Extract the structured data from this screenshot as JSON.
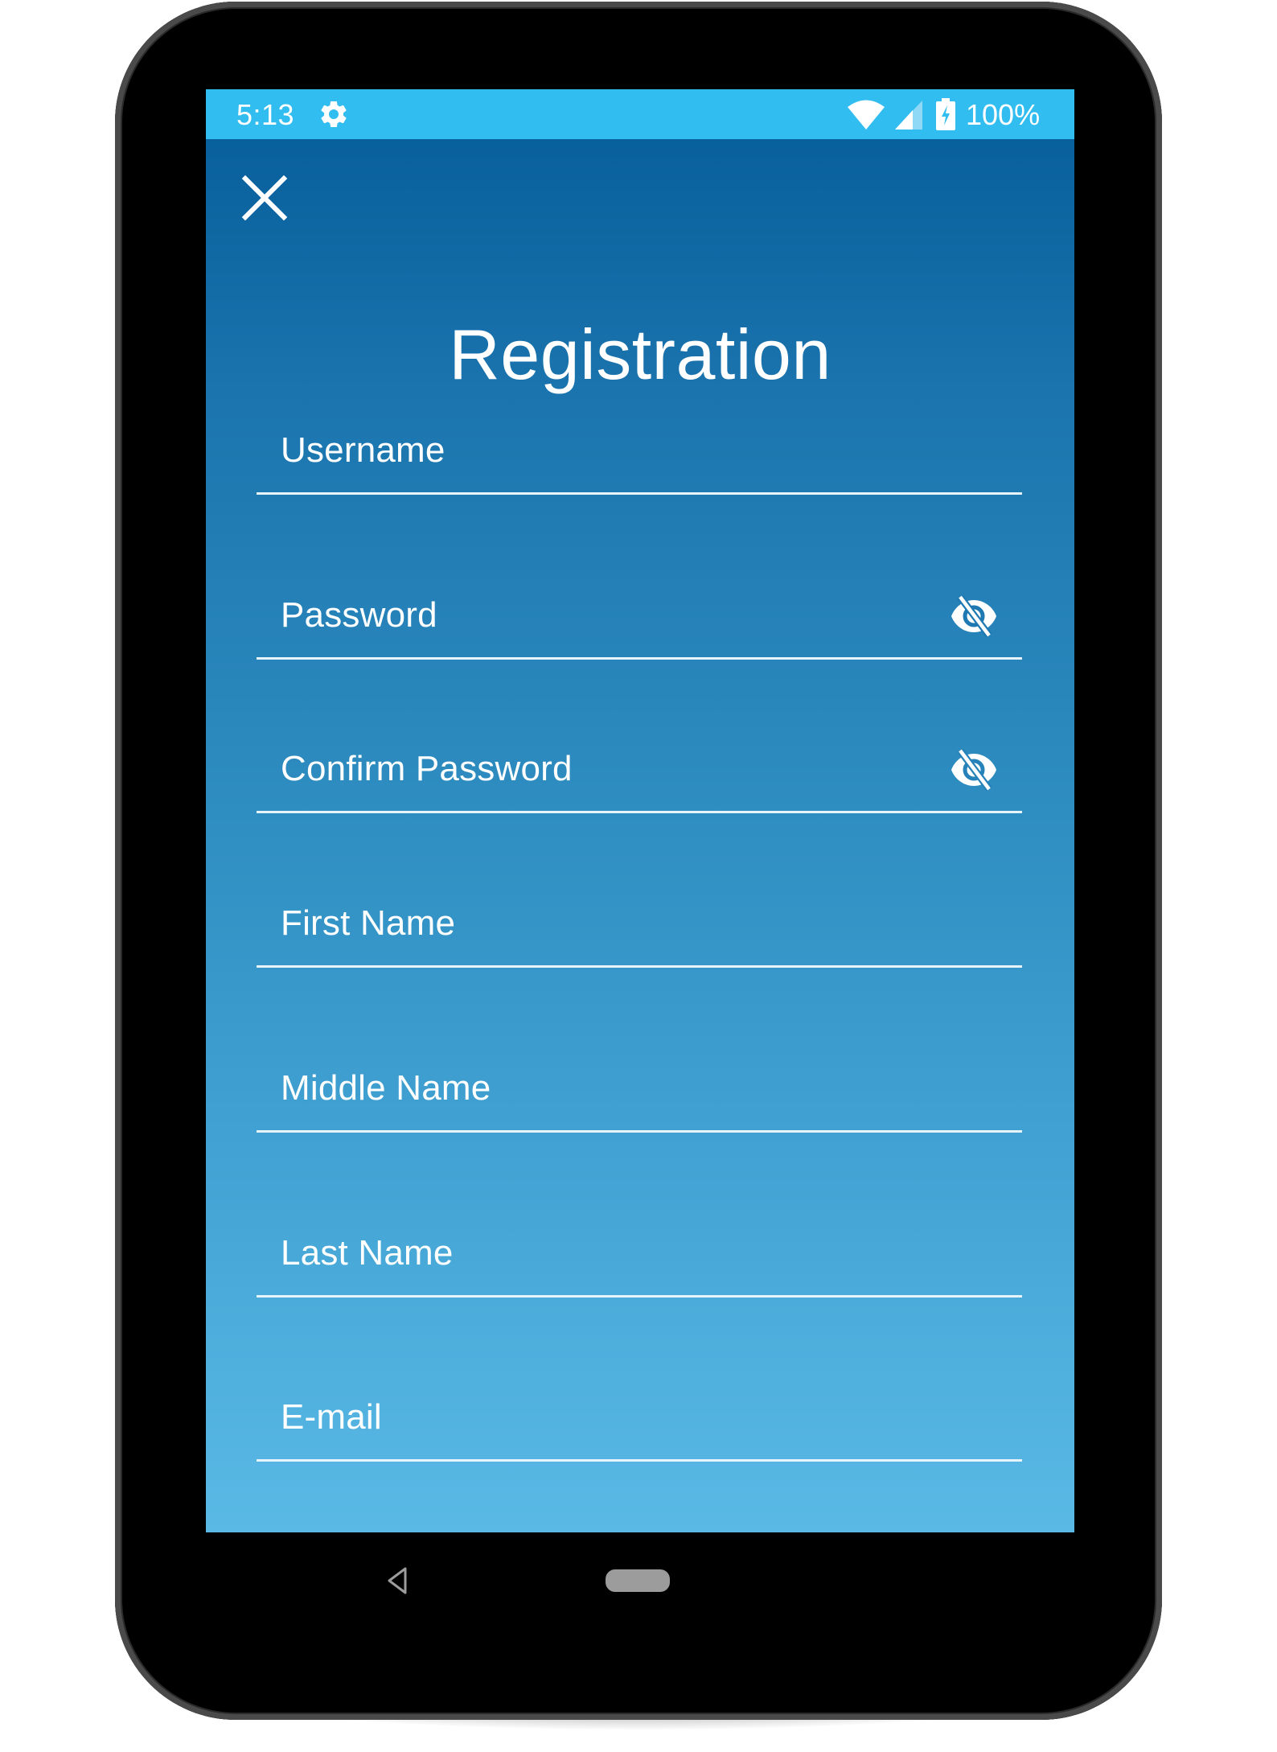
{
  "status_bar": {
    "time": "5:13",
    "battery_percent": "100%",
    "icons": [
      "gear-icon",
      "wifi-icon",
      "cellular-signal-icon",
      "battery-charging-icon"
    ],
    "color": "#31bdf0"
  },
  "header": {
    "close_icon": "close-icon",
    "title": "Registration"
  },
  "form": {
    "fields": [
      {
        "label": "Username",
        "type": "text",
        "value": ""
      },
      {
        "label": "Password",
        "type": "password",
        "value": "",
        "toggle_icon": "visibility-off-icon"
      },
      {
        "label": "Confirm Password",
        "type": "password",
        "value": "",
        "toggle_icon": "visibility-off-icon"
      },
      {
        "label": "First Name",
        "type": "text",
        "value": ""
      },
      {
        "label": "Middle Name",
        "type": "text",
        "value": ""
      },
      {
        "label": "Last Name",
        "type": "text",
        "value": ""
      },
      {
        "label": "E-mail",
        "type": "email",
        "value": ""
      }
    ]
  },
  "navigation_bar": {
    "buttons": [
      "back",
      "home"
    ]
  },
  "theme": {
    "gradient_top": "#045b98",
    "gradient_bottom": "#5ab9e5",
    "text_color": "#ffffff"
  }
}
